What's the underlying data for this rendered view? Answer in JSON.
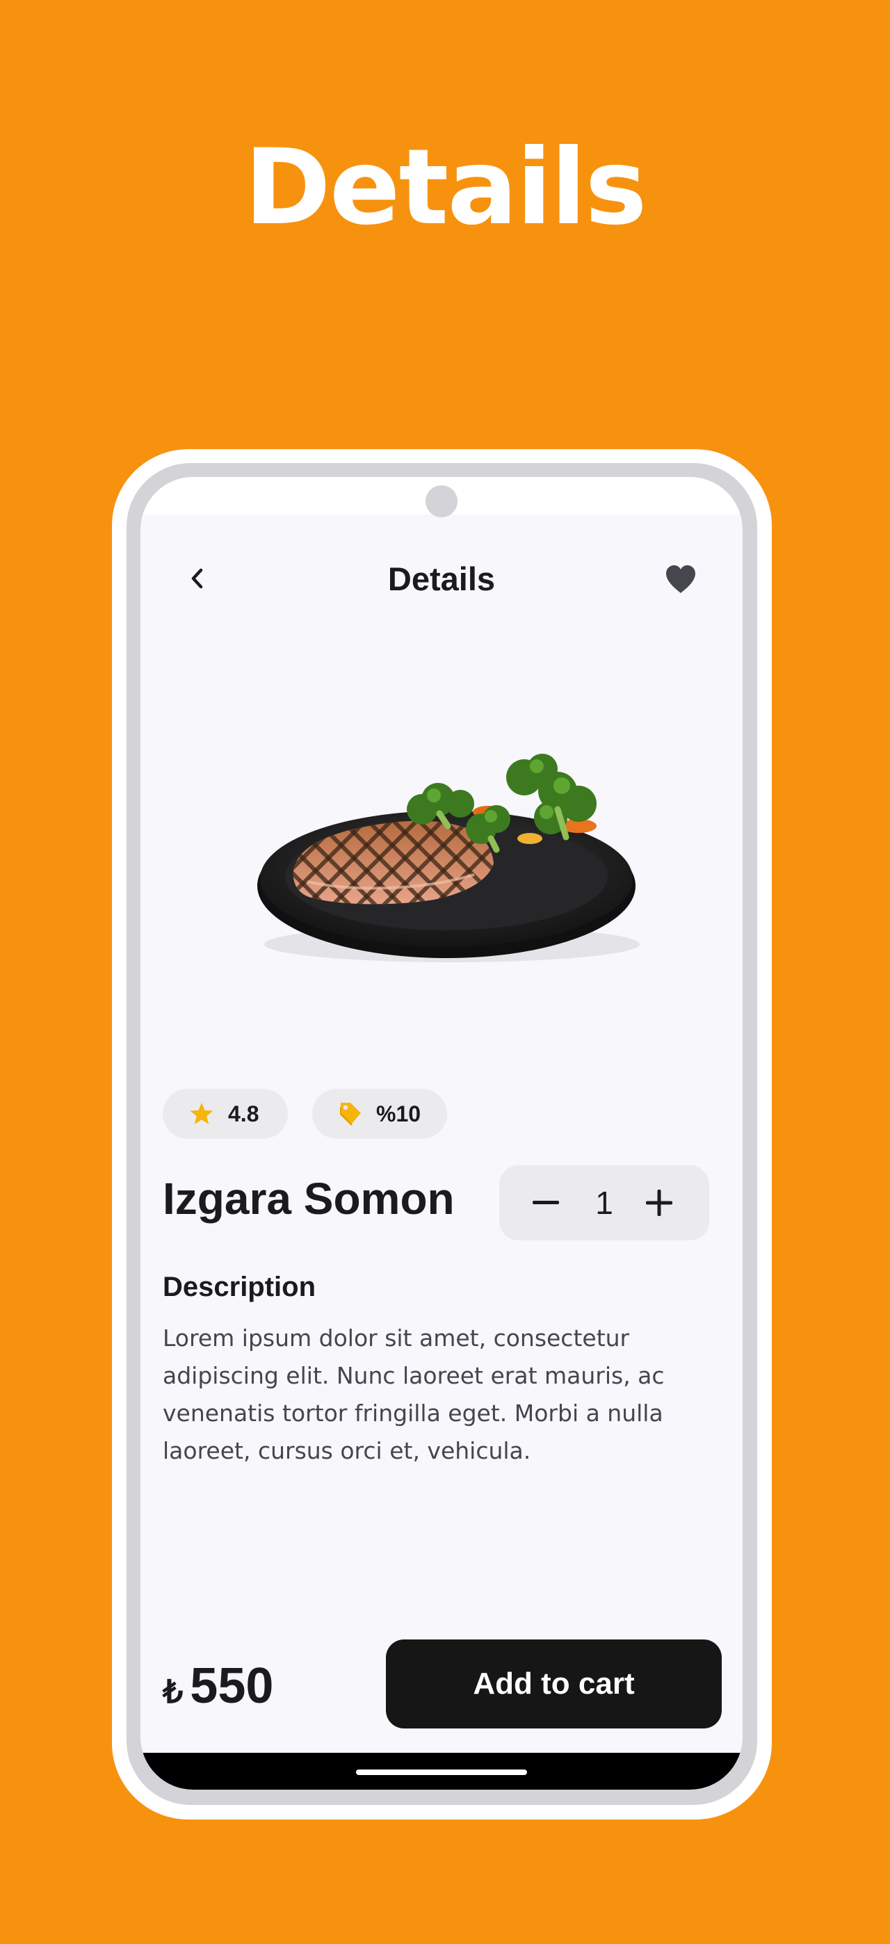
{
  "headline": "Details",
  "app": {
    "title": "Details",
    "back_icon": "chevron-left-icon",
    "favorite_icon": "heart-icon"
  },
  "product": {
    "image_alt": "grilled salmon with broccoli",
    "rating": "4.8",
    "discount": "%10",
    "name": "Izgara Somon",
    "quantity": "1",
    "description_title": "Description",
    "description": "Lorem ipsum dolor sit amet, consectetur adipiscing elit. Nunc laoreet erat mauris, ac venenatis tortor fringilla eget. Morbi a nulla laoreet, cursus orci et, vehicula.",
    "currency": "₺",
    "price": "550"
  },
  "actions": {
    "add_to_cart": "Add to cart"
  },
  "colors": {
    "background": "#F7920F",
    "screen": "#F7F7FC",
    "chip": "#EBEBEE",
    "star": "#F5B50A",
    "primary_button": "#161616",
    "text": "#1B1B1F"
  }
}
